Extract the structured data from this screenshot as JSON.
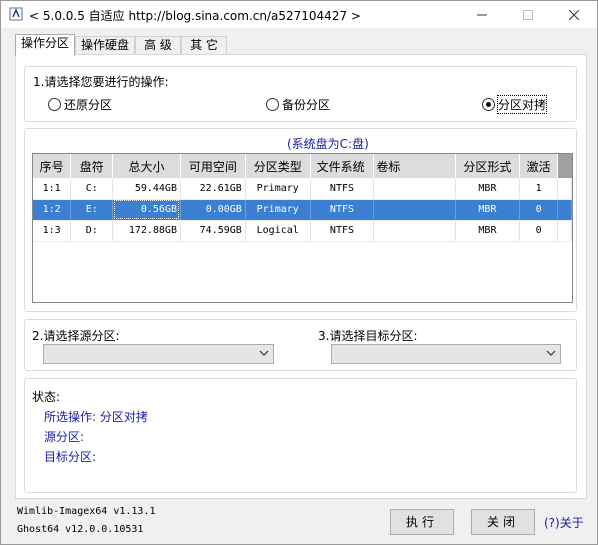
{
  "window": {
    "title": "< 5.0.0.5 自适应 http://blog.sina.com.cn/a527104427 >"
  },
  "tabs": [
    {
      "label": "操作分区",
      "active": true
    },
    {
      "label": "操作硬盘",
      "active": false
    },
    {
      "label": "高 级",
      "active": false
    },
    {
      "label": "其 它",
      "active": false
    }
  ],
  "operation": {
    "prompt": "1.请选择您要进行的操作:",
    "options": [
      {
        "label": "还原分区",
        "checked": false
      },
      {
        "label": "备份分区",
        "checked": false
      },
      {
        "label": "分区对拷",
        "checked": true
      }
    ]
  },
  "system_disk_note": "(系统盘为C:盘)",
  "partition_table": {
    "columns": [
      "序号",
      "盘符",
      "总大小",
      "可用空间",
      "分区类型",
      "文件系统",
      "卷标",
      "分区形式",
      "激活"
    ],
    "rows": [
      {
        "index": "1:1",
        "drive": "C:",
        "total": "59.44GB",
        "free": "22.61GB",
        "type": "Primary",
        "fs": "NTFS",
        "label": "",
        "form": "MBR",
        "active": "1",
        "selected": false
      },
      {
        "index": "1:2",
        "drive": "E:",
        "total": "0.56GB",
        "free": "0.00GB",
        "type": "Primary",
        "fs": "NTFS",
        "label": "",
        "form": "MBR",
        "active": "0",
        "selected": true
      },
      {
        "index": "1:3",
        "drive": "D:",
        "total": "172.88GB",
        "free": "74.59GB",
        "type": "Logical",
        "fs": "NTFS",
        "label": "",
        "form": "MBR",
        "active": "0",
        "selected": false
      }
    ]
  },
  "source": {
    "prompt": "2.请选择源分区:",
    "value": ""
  },
  "target": {
    "prompt": "3.请选择目标分区:",
    "value": ""
  },
  "status": {
    "heading": "状态:",
    "lines": [
      "所选操作: 分区对拷",
      "源分区:",
      "目标分区:"
    ]
  },
  "footer": {
    "line1": "Wimlib-Imagex64 v1.13.1",
    "line2": "Ghost64 v12.0.0.10531"
  },
  "buttons": {
    "execute": "执行",
    "close": "关闭",
    "about": "关于",
    "about_mark": "(?)"
  },
  "colors": {
    "selection": "#3a7fd2",
    "status_text": "#1a1aa6",
    "note_text": "#1a1aa6"
  }
}
